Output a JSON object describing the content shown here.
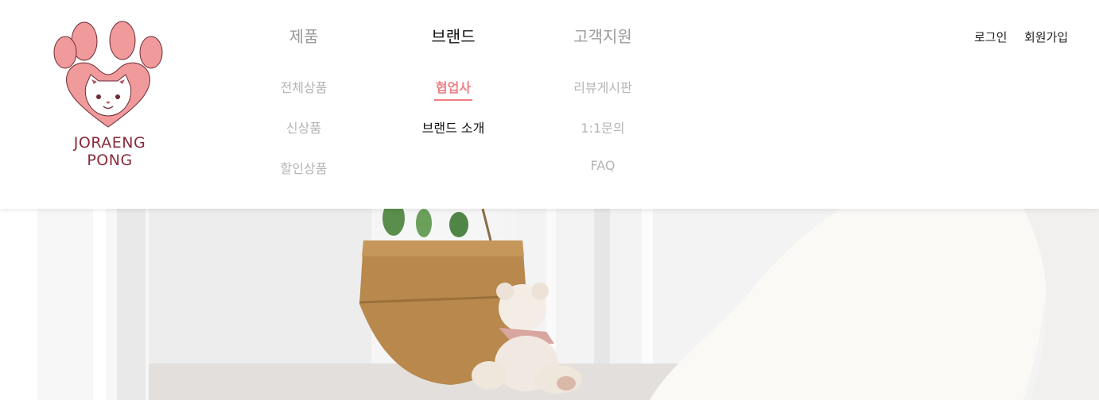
{
  "logo": {
    "text": "JORAENG PONG"
  },
  "nav": {
    "products": {
      "label": "제품",
      "items": [
        "전체상품",
        "신상품",
        "할인상품"
      ]
    },
    "brand": {
      "label": "브랜드",
      "items": [
        "협업사",
        "브랜드 소개"
      ]
    },
    "support": {
      "label": "고객지원",
      "items": [
        "리뷰게시판",
        "1:1문의",
        "FAQ"
      ]
    }
  },
  "auth": {
    "login": "로그인",
    "signup": "회원가입"
  },
  "colors": {
    "accent": "#ef7f84",
    "logo_text": "#8b2a3a",
    "paw": "#f09a9c"
  }
}
